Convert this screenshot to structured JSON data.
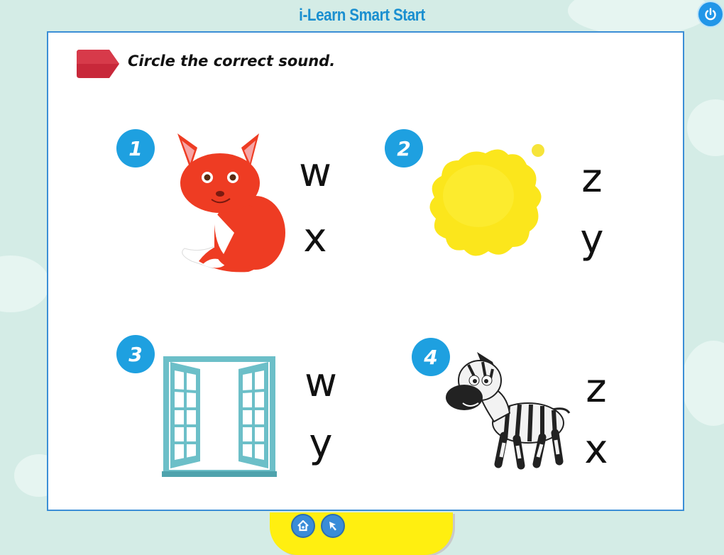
{
  "app": {
    "title": "i-Learn Smart Start"
  },
  "activity": {
    "instruction": "Circle the correct sound.",
    "items": [
      {
        "number": "1",
        "picture": "fox",
        "options": [
          "w",
          "x"
        ]
      },
      {
        "number": "2",
        "picture": "sun",
        "options": [
          "z",
          "y"
        ]
      },
      {
        "number": "3",
        "picture": "window",
        "options": [
          "w",
          "y"
        ]
      },
      {
        "number": "4",
        "picture": "zebra",
        "options": [
          "z",
          "x"
        ]
      }
    ]
  },
  "controls": {
    "power_icon": "power-icon",
    "home_icon": "home-icon",
    "back_icon": "cursor-arrow-icon"
  },
  "colors": {
    "background": "#d4ece6",
    "accent_blue": "#1ea0e0",
    "tag_red": "#c8283a",
    "bottom_bar": "#ffef10",
    "title": "#1a8fd0"
  }
}
